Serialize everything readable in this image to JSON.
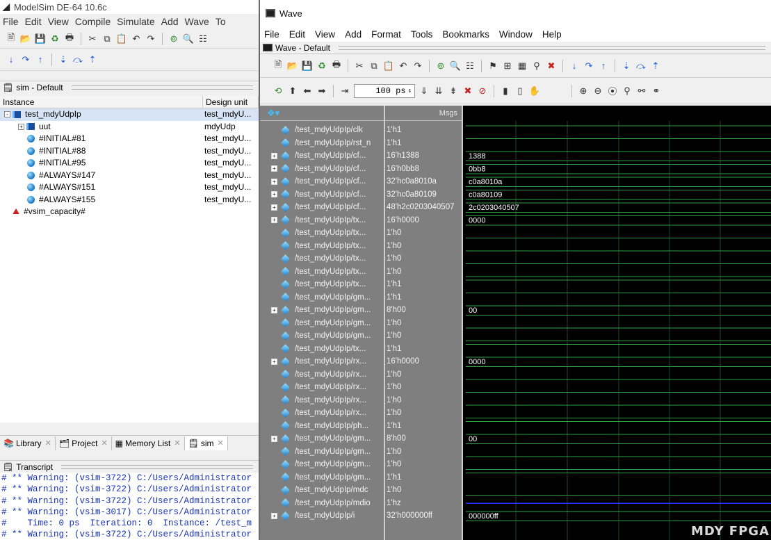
{
  "main_window": {
    "title": "ModelSim DE-64 10.6c",
    "menu": [
      "File",
      "Edit",
      "View",
      "Compile",
      "Simulate",
      "Add",
      "Wave",
      "To"
    ],
    "sim_pane_title": "sim - Default",
    "columns": [
      "Instance",
      "Design unit"
    ],
    "instances": [
      {
        "name": "test_mdyUdpIp",
        "unit": "test_mdyU...",
        "kind": "module",
        "expander": "-",
        "indent": 0,
        "selected": true
      },
      {
        "name": "uut",
        "unit": "mdyUdp",
        "kind": "module",
        "expander": "+",
        "indent": 1,
        "selected": false
      },
      {
        "name": "#INITIAL#81",
        "unit": "test_mdyU...",
        "kind": "process",
        "expander": "",
        "indent": 1,
        "selected": false
      },
      {
        "name": "#INITIAL#88",
        "unit": "test_mdyU...",
        "kind": "process",
        "expander": "",
        "indent": 1,
        "selected": false
      },
      {
        "name": "#INITIAL#95",
        "unit": "test_mdyU...",
        "kind": "process",
        "expander": "",
        "indent": 1,
        "selected": false
      },
      {
        "name": "#ALWAYS#147",
        "unit": "test_mdyU...",
        "kind": "process",
        "expander": "",
        "indent": 1,
        "selected": false
      },
      {
        "name": "#ALWAYS#151",
        "unit": "test_mdyU...",
        "kind": "process",
        "expander": "",
        "indent": 1,
        "selected": false
      },
      {
        "name": "#ALWAYS#155",
        "unit": "test_mdyU...",
        "kind": "process",
        "expander": "",
        "indent": 1,
        "selected": false
      },
      {
        "name": "#vsim_capacity#",
        "unit": "",
        "kind": "capacity",
        "expander": "",
        "indent": 0,
        "selected": false
      }
    ],
    "tabs": [
      {
        "label": "Library",
        "active": false
      },
      {
        "label": "Project",
        "active": false
      },
      {
        "label": "Memory List",
        "active": false
      },
      {
        "label": "sim",
        "active": true
      }
    ],
    "transcript_title": "Transcript",
    "transcript_lines": [
      "# ** Warning: (vsim-3722) C:/Users/Administrator",
      "# ** Warning: (vsim-3722) C:/Users/Administrator",
      "# ** Warning: (vsim-3722) C:/Users/Administrator",
      "# ** Warning: (vsim-3017) C:/Users/Administrator",
      "#    Time: 0 ps  Iteration: 0  Instance: /test_m",
      "# ** Warning: (vsim-3722) C:/Users/Administrator"
    ]
  },
  "wave_window": {
    "title": "Wave",
    "menu": [
      "File",
      "Edit",
      "View",
      "Add",
      "Format",
      "Tools",
      "Bookmarks",
      "Window",
      "Help"
    ],
    "subtitle": "Wave - Default",
    "time_value": "100 ps",
    "msgs_header": "Msgs",
    "signals": [
      {
        "name": "/test_mdyUdpIp/clk",
        "value": "1'h1",
        "bus": false,
        "wave": null
      },
      {
        "name": "/test_mdyUdpIp/rst_n",
        "value": "1'h1",
        "bus": false,
        "wave": null
      },
      {
        "name": "/test_mdyUdpIp/cf...",
        "value": "16'h1388",
        "bus": true,
        "wave": "1388"
      },
      {
        "name": "/test_mdyUdpIp/cf...",
        "value": "16'h0bb8",
        "bus": true,
        "wave": "0bb8"
      },
      {
        "name": "/test_mdyUdpIp/cf...",
        "value": "32'hc0a8010a",
        "bus": true,
        "wave": "c0a8010a"
      },
      {
        "name": "/test_mdyUdpIp/cf...",
        "value": "32'hc0a80109",
        "bus": true,
        "wave": "c0a80109"
      },
      {
        "name": "/test_mdyUdpIp/cf...",
        "value": "48'h2c0203040507",
        "bus": true,
        "wave": "2c0203040507"
      },
      {
        "name": "/test_mdyUdpIp/tx...",
        "value": "16'h0000",
        "bus": true,
        "wave": "0000"
      },
      {
        "name": "/test_mdyUdpIp/tx...",
        "value": "1'h0",
        "bus": false,
        "wave": null
      },
      {
        "name": "/test_mdyUdpIp/tx...",
        "value": "1'h0",
        "bus": false,
        "wave": null
      },
      {
        "name": "/test_mdyUdpIp/tx...",
        "value": "1'h0",
        "bus": false,
        "wave": null
      },
      {
        "name": "/test_mdyUdpIp/tx...",
        "value": "1'h0",
        "bus": false,
        "wave": null
      },
      {
        "name": "/test_mdyUdpIp/tx...",
        "value": "1'h1",
        "bus": false,
        "wave": null
      },
      {
        "name": "/test_mdyUdpIp/gm...",
        "value": "1'h1",
        "bus": false,
        "wave": null
      },
      {
        "name": "/test_mdyUdpIp/gm...",
        "value": "8'h00",
        "bus": true,
        "wave": "00"
      },
      {
        "name": "/test_mdyUdpIp/gm...",
        "value": "1'h0",
        "bus": false,
        "wave": null
      },
      {
        "name": "/test_mdyUdpIp/gm...",
        "value": "1'h0",
        "bus": false,
        "wave": null
      },
      {
        "name": "/test_mdyUdpIp/tx...",
        "value": "1'h1",
        "bus": false,
        "wave": null
      },
      {
        "name": "/test_mdyUdpIp/rx...",
        "value": "16'h0000",
        "bus": true,
        "wave": "0000"
      },
      {
        "name": "/test_mdyUdpIp/rx...",
        "value": "1'h0",
        "bus": false,
        "wave": null
      },
      {
        "name": "/test_mdyUdpIp/rx...",
        "value": "1'h0",
        "bus": false,
        "wave": null
      },
      {
        "name": "/test_mdyUdpIp/rx...",
        "value": "1'h0",
        "bus": false,
        "wave": null
      },
      {
        "name": "/test_mdyUdpIp/rx...",
        "value": "1'h0",
        "bus": false,
        "wave": null
      },
      {
        "name": "/test_mdyUdpIp/ph...",
        "value": "1'h1",
        "bus": false,
        "wave": null
      },
      {
        "name": "/test_mdyUdpIp/gm...",
        "value": "8'h00",
        "bus": true,
        "wave": "00"
      },
      {
        "name": "/test_mdyUdpIp/gm...",
        "value": "1'h0",
        "bus": false,
        "wave": null
      },
      {
        "name": "/test_mdyUdpIp/gm...",
        "value": "1'h0",
        "bus": false,
        "wave": null
      },
      {
        "name": "/test_mdyUdpIp/gm...",
        "value": "1'h1",
        "bus": false,
        "wave": null
      },
      {
        "name": "/test_mdyUdpIp/mdc",
        "value": "1'h0",
        "bus": false,
        "wave": null
      },
      {
        "name": "/test_mdyUdpIp/mdio",
        "value": "1'hz",
        "bus": false,
        "wave": null
      },
      {
        "name": "/test_mdyUdpIp/i",
        "value": "32'h000000ff",
        "bus": true,
        "wave": "000000ff"
      }
    ],
    "colors": {
      "wave_green": "#2ea043",
      "wave_blue": "#2233ff",
      "grid": "#1d4d1d",
      "pane_bg": "#7f7f7f"
    }
  },
  "watermark": "MDY FPGA"
}
